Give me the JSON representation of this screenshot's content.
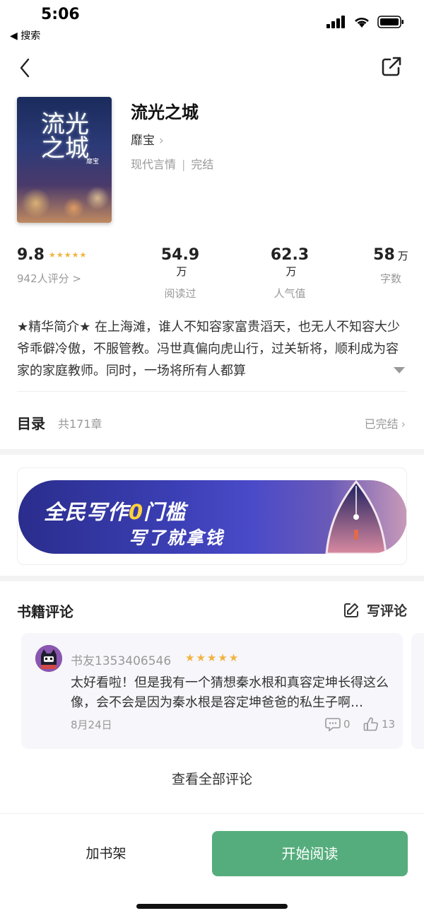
{
  "status_bar": {
    "time": "5:06",
    "back_label": "◀ 搜索"
  },
  "book": {
    "title": "流光之城",
    "author": "靡宝",
    "genre": "现代言情",
    "separator": "|",
    "status": "完结",
    "cover_title": "流光之城",
    "cover_author": "靡宝"
  },
  "stats": {
    "rating": {
      "value": "9.8",
      "label": "942人评分 >",
      "stars": 5
    },
    "reads": {
      "value": "54.9",
      "unit": "万",
      "label": "阅读过"
    },
    "popularity": {
      "value": "62.3",
      "unit": "万",
      "label": "人气值"
    },
    "words": {
      "value": "58",
      "unit": "万",
      "label": "字数"
    }
  },
  "intro": "★精华简介★ 在上海滩，谁人不知容家富贵滔天，也无人不知容大少爷乖僻冷傲，不服管教。冯世真偏向虎山行，过关斩将，顺利成为容家的家庭教师。同时，一场将所有人都算",
  "toc": {
    "title": "目录",
    "count": "共171章",
    "status": "已完结"
  },
  "banner": {
    "line1_a": "全民写作",
    "line1_zero": "0",
    "line1_b": "门槛",
    "line2": "写了就拿钱"
  },
  "reviews": {
    "header": "书籍评论",
    "write_label": "写评论",
    "items": [
      {
        "user": "书友1353406546",
        "stars": 5,
        "text": "太好看啦！但是我有一个猜想秦水根和真容定坤长得这么像，会不会是因为秦水根是容定坤爸爸的私生子啊…",
        "date": "8月24日",
        "replies": "0",
        "likes": "13"
      }
    ],
    "view_all": "查看全部评论"
  },
  "bottom": {
    "add_shelf": "加书架",
    "start_read": "开始阅读"
  },
  "colors": {
    "accent": "#55ad7d",
    "star": "#f2b33d",
    "banner": "#3b3fb4"
  }
}
